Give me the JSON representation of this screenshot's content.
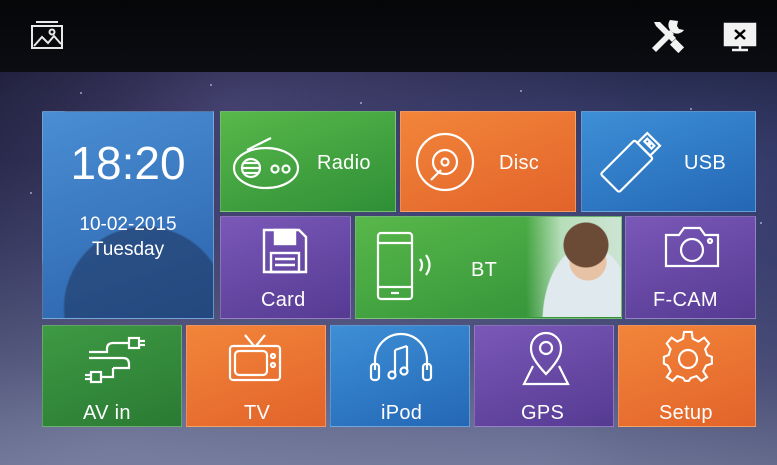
{
  "topbar": {
    "left_icon": "wallpaper-icon",
    "right_icons": [
      "settings-tools-icon",
      "screen-off-icon"
    ]
  },
  "clock": {
    "time": "18:20",
    "date": "10-02-2015",
    "day": "Tuesday"
  },
  "tiles": {
    "radio": {
      "label": "Radio",
      "icon": "radio-icon",
      "color": "#4aa944"
    },
    "disc": {
      "label": "Disc",
      "icon": "disc-icon",
      "color": "#ee7432"
    },
    "usb": {
      "label": "USB",
      "icon": "usb-icon",
      "color": "#3479c8"
    },
    "card": {
      "label": "Card",
      "icon": "sd-card-icon",
      "color": "#6a4aa6"
    },
    "bt": {
      "label": "BT",
      "icon": "bluetooth-phone-icon",
      "color": "#4aa944"
    },
    "fcam": {
      "label": "F-CAM",
      "icon": "camera-icon",
      "color": "#6a4aa6"
    },
    "avin": {
      "label": "AV in",
      "icon": "av-plug-icon",
      "color": "#3c963f"
    },
    "tv": {
      "label": "TV",
      "icon": "tv-icon",
      "color": "#ee7432"
    },
    "ipod": {
      "label": "iPod",
      "icon": "headphones-music-icon",
      "color": "#3479c8"
    },
    "gps": {
      "label": "GPS",
      "icon": "map-pin-icon",
      "color": "#6a4aa6"
    },
    "setup": {
      "label": "Setup",
      "icon": "gear-icon",
      "color": "#ee7432"
    }
  }
}
